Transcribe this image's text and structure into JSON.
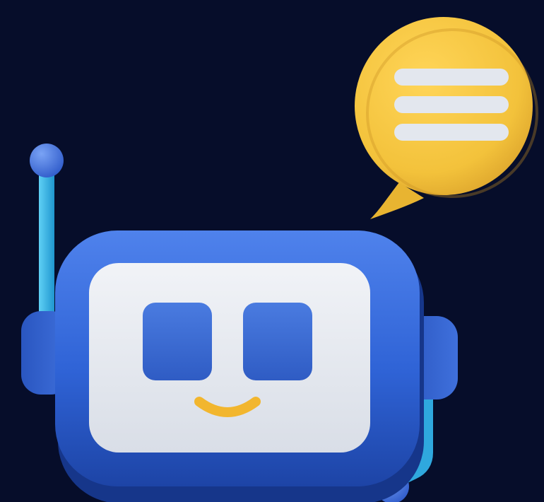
{
  "scene": {
    "subject": "chatbot-robot-icon",
    "colors": {
      "background": "#060d2a",
      "robot_body": "#2f63d6",
      "robot_body_shade": "#1d44a6",
      "robot_body_highlight": "#4f82ec",
      "face_screen": "#e6eaf0",
      "eyes": "#3a6bd2",
      "smile": "#f2b62e",
      "antenna_rod": "#2fb3e8",
      "antenna_ball": "#3f6fd8",
      "speech_bubble": "#f3c23b",
      "speech_bubble_shade": "#d9a02a",
      "bubble_lines": "#e3e7ee"
    },
    "icons": [
      "robot-head-icon",
      "speech-bubble-icon",
      "antenna-icon",
      "headset-microphone-icon"
    ]
  }
}
